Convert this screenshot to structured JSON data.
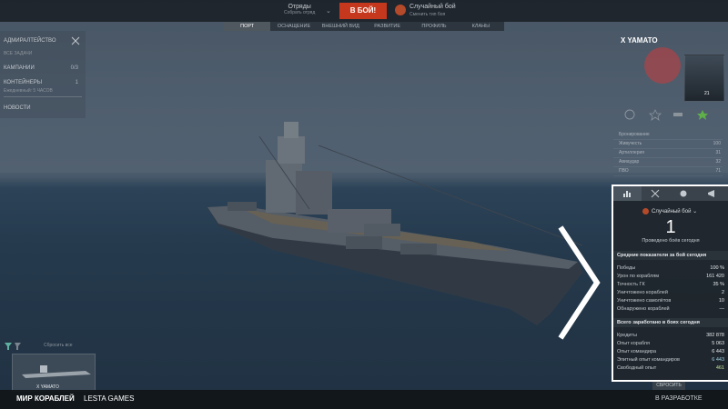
{
  "topbar": {
    "squads_title": "Отряды",
    "squads_sub": "Собрать отряд",
    "battle_button": "В БОЙ!",
    "mode_title": "Случайный бой",
    "mode_sub": "Сменить тип боя"
  },
  "tabs": [
    "ПОРТ",
    "ОСНАЩЕНИЕ",
    "ВНЕШНИЙ ВИД",
    "РАЗВИТИЕ",
    "ПРОФИЛЬ",
    "КЛАНЫ"
  ],
  "left_panel": {
    "admiralty": "АДМИРАЛТЕЙСТВО",
    "tasks": "ВСЕ ЗАДАЧИ",
    "campaigns": "КАМПАНИИ",
    "campaigns_value": "0/3",
    "containers": "КОНТЕЙНЕРЫ",
    "containers_value": "1",
    "containers_sub": "Ежедневный: 5 ЧАСОВ",
    "news": "НОВОСТИ"
  },
  "ship_info": {
    "name": "X YAMATO",
    "level": "21",
    "modules": [
      {
        "label": "Бронирование",
        "value": ""
      },
      {
        "label": "Живучесть",
        "value": "100"
      },
      {
        "label": "Артиллерия",
        "value": "31"
      },
      {
        "label": "Авиаудар",
        "value": "32"
      },
      {
        "label": "ПВО",
        "value": "71"
      }
    ]
  },
  "stats": {
    "mode": "Случайный бой",
    "battles_count": "1",
    "battles_label": "Проведено боёв сегодня",
    "avg_header": "Средние показатели за бой сегодня",
    "avg_rows": [
      {
        "label": "Победы",
        "value": "100 %"
      },
      {
        "label": "Урон по кораблям",
        "value": "161 420"
      },
      {
        "label": "Точность ГК",
        "value": "35 %"
      },
      {
        "label": "Уничтожено кораблей",
        "value": "2"
      },
      {
        "label": "Уничтожено самолётов",
        "value": "10"
      },
      {
        "label": "Обнаружено кораблей",
        "value": "—"
      }
    ],
    "earn_header": "Всего заработано в боях сегодня",
    "earn_rows": [
      {
        "label": "Кредиты",
        "value": "382 878"
      },
      {
        "label": "Опыт корабля",
        "value": "5 063"
      },
      {
        "label": "Опыт командира",
        "value": "6 443"
      },
      {
        "label": "Элитный опыт командиров",
        "value": "6 443"
      },
      {
        "label": "Свободный опыт",
        "value": "461"
      }
    ],
    "reset_label": "СБРОСИТЬ"
  },
  "carousel": {
    "filter_label": "Сбросить все",
    "ship_card_name": "X YAMATO"
  },
  "bottombar": {
    "logo_text": "МИР КОРАБЛЕЙ",
    "publisher": "LESTA GAMES",
    "dev_label": "В РАЗРАБОТКЕ"
  },
  "colors": {
    "battle_button": "#c6381d",
    "stats_border": "#ffffff",
    "accent_green": "#a7d67a"
  }
}
